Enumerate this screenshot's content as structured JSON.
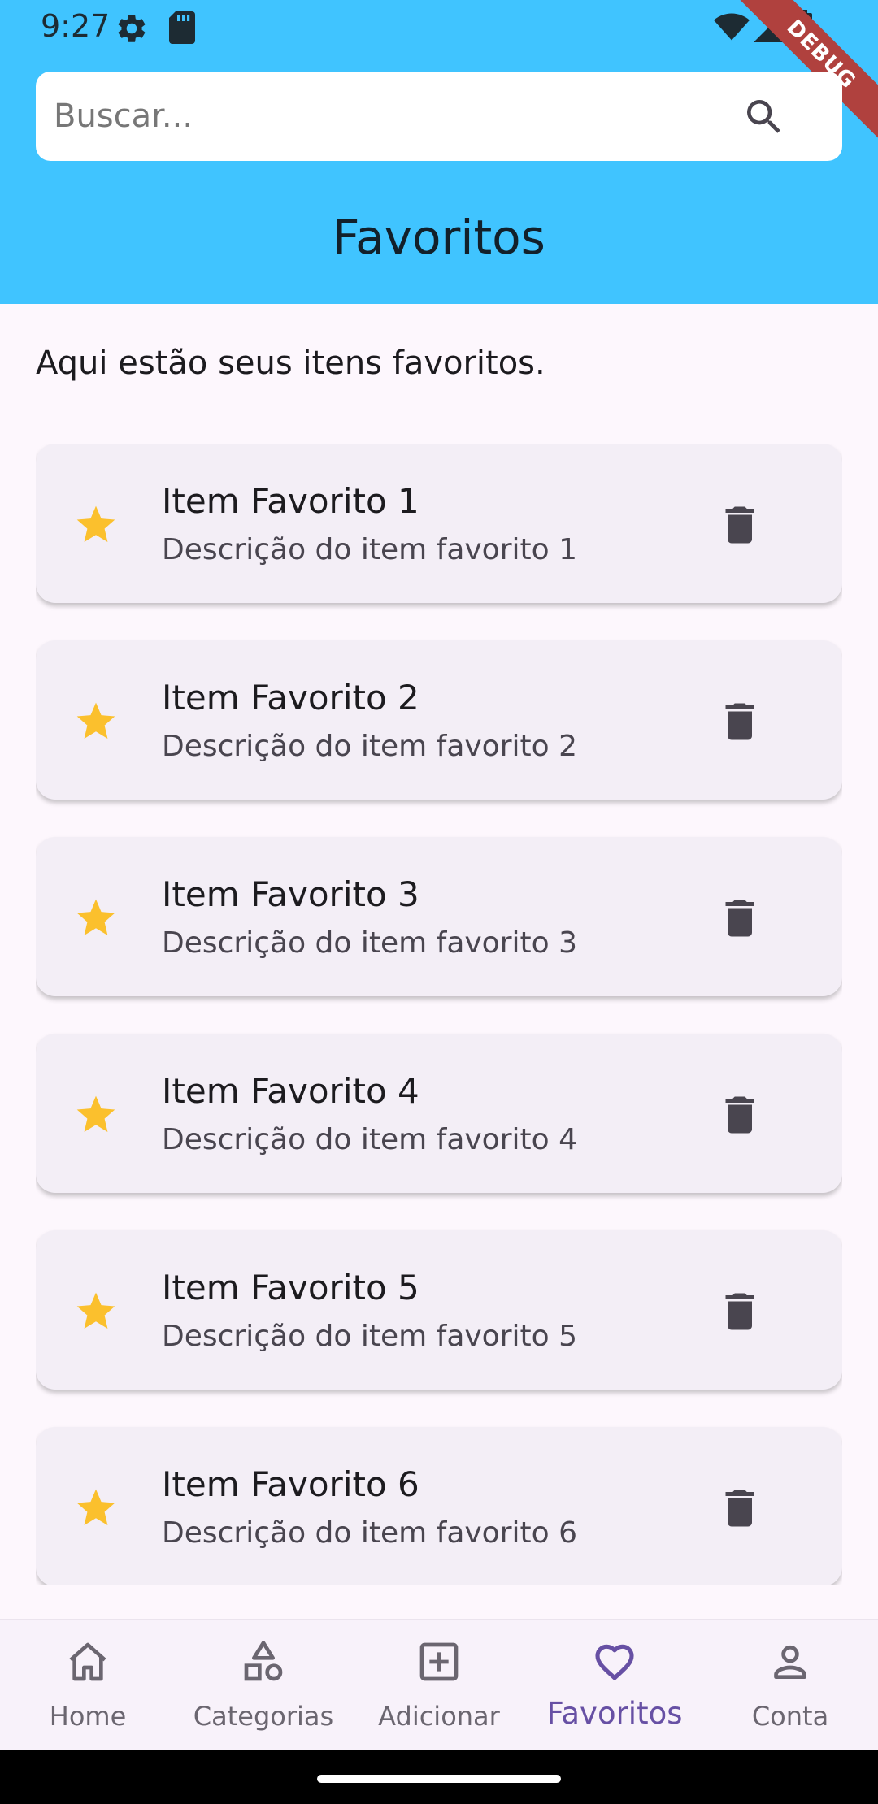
{
  "status_bar": {
    "time": "9:27",
    "icons": [
      "gear-icon",
      "sd-card-icon",
      "wifi-icon",
      "signal-icon",
      "battery-icon"
    ]
  },
  "debug_banner": "DEBUG",
  "search": {
    "placeholder": "Buscar...",
    "value": "",
    "icon": "search-icon"
  },
  "app_bar": {
    "title": "Favoritos"
  },
  "intro_text": "Aqui estão seus itens favoritos.",
  "favorites": [
    {
      "title": "Item Favorito 1",
      "description": "Descrição do item favorito 1"
    },
    {
      "title": "Item Favorito 2",
      "description": "Descrição do item favorito 2"
    },
    {
      "title": "Item Favorito 3",
      "description": "Descrição do item favorito 3"
    },
    {
      "title": "Item Favorito 4",
      "description": "Descrição do item favorito 4"
    },
    {
      "title": "Item Favorito 5",
      "description": "Descrição do item favorito 5"
    },
    {
      "title": "Item Favorito 6",
      "description": "Descrição do item favorito 6"
    }
  ],
  "bottom_nav": {
    "items": [
      {
        "label": "Home",
        "icon": "home-icon"
      },
      {
        "label": "Categorias",
        "icon": "shapes-icon"
      },
      {
        "label": "Adicionar",
        "icon": "add-box-icon"
      },
      {
        "label": "Favoritos",
        "icon": "heart-icon",
        "active": true
      },
      {
        "label": "Conta",
        "icon": "person-icon"
      }
    ]
  },
  "colors": {
    "header": "#40c4ff",
    "background": "#fdf7fd",
    "card": "#f3eef6",
    "star": "#fbc02d",
    "active_nav": "#6750a4",
    "debug_ribbon": "#b0413e"
  }
}
